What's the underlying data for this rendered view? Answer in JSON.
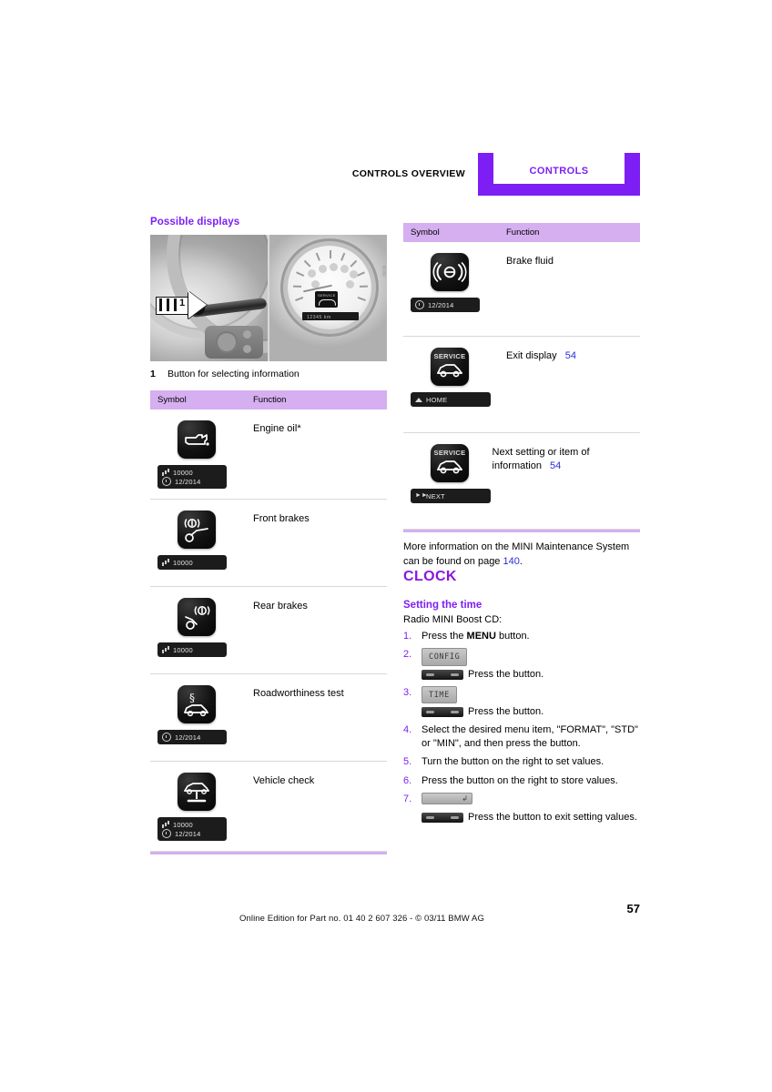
{
  "header": {
    "overview_label": "CONTROLS OVERVIEW",
    "chapter_tab": "CONTROLS"
  },
  "left_column": {
    "section_heading": "Possible displays",
    "figure": {
      "callout_number": "1",
      "caption": "Button for selecting information",
      "instrument_badge_text": "SERVICE",
      "odometer_text": "12345 km"
    },
    "table": {
      "columns": [
        "Symbol",
        "Function"
      ],
      "rows": [
        {
          "function": "Engine oil*",
          "icon": "oil-can-icon",
          "strip": [
            {
              "icon": "gauge-icon",
              "value": "10000"
            },
            {
              "icon": "clock-icon",
              "value": "12/2014"
            }
          ]
        },
        {
          "function": "Front brakes",
          "icon": "front-brakes-icon",
          "strip": [
            {
              "icon": "gauge-icon",
              "value": "10000"
            }
          ]
        },
        {
          "function": "Rear brakes",
          "icon": "rear-brakes-icon",
          "strip": [
            {
              "icon": "gauge-icon",
              "value": "10000"
            }
          ]
        },
        {
          "function": "Roadworthiness test",
          "icon": "roadworthiness-icon",
          "strip": [
            {
              "icon": "clock-icon",
              "value": "12/2014"
            }
          ]
        },
        {
          "function": "Vehicle check",
          "icon": "vehicle-check-icon",
          "strip": [
            {
              "icon": "gauge-icon",
              "value": "10000"
            },
            {
              "icon": "clock-icon",
              "value": "12/2014"
            }
          ]
        }
      ]
    }
  },
  "right_column": {
    "table": {
      "columns": [
        "Symbol",
        "Function"
      ],
      "rows": [
        {
          "function": "Brake fluid",
          "function_ref": "",
          "icon": "brake-fluid-icon",
          "icon_label": "",
          "strip": [
            {
              "icon": "clock-icon",
              "value": "12/2014"
            }
          ]
        },
        {
          "function": "Exit display",
          "function_ref": "54",
          "icon": "service-car-icon",
          "icon_label": "SERVICE",
          "strip_label": "HOME",
          "strip_icon": "triangle-up-icon"
        },
        {
          "function": "Next setting or item of information",
          "function_ref": "54",
          "icon": "service-car-icon",
          "icon_label": "SERVICE",
          "strip_label": "NEXT",
          "strip_icon": "fast-forward-icon"
        }
      ]
    },
    "note": {
      "text_before": "More information on the MINI Maintenance System can be found on page ",
      "page_ref": "140",
      "text_after": "."
    },
    "clock": {
      "heading": "CLOCK",
      "subheading": "Setting the time",
      "lead": "Radio MINI Boost CD:",
      "steps": [
        {
          "num": "1.",
          "type": "text",
          "text_before": "Press the ",
          "bold": "MENU",
          "text_after": " button."
        },
        {
          "num": "2.",
          "type": "button",
          "lcd": "CONFIG",
          "text": "Press the button."
        },
        {
          "num": "3.",
          "type": "button",
          "lcd": "TIME",
          "text": "Press the button."
        },
        {
          "num": "4.",
          "type": "text",
          "text_before": "Select the desired menu item, \"FORMAT\", \"STD\" or \"MIN\", and then press the button.",
          "bold": "",
          "text_after": ""
        },
        {
          "num": "5.",
          "type": "text",
          "text_before": "Turn the button on the right to set values.",
          "bold": "",
          "text_after": ""
        },
        {
          "num": "6.",
          "type": "text",
          "text_before": "Press the button on the right to store values.",
          "bold": "",
          "text_after": ""
        },
        {
          "num": "7.",
          "type": "button",
          "lcd": "back-arrow-icon",
          "text": "Press the button to exit setting values."
        }
      ]
    }
  },
  "footer": {
    "edition_text": "Online Edition for Part no. 01 40 2 607 326 - © 03/11 BMW AG",
    "page_number": "57"
  },
  "colors": {
    "purple_accent": "#7d1ef4",
    "table_header_bg": "#d5aff0",
    "link_blue": "#2b2bd8"
  }
}
